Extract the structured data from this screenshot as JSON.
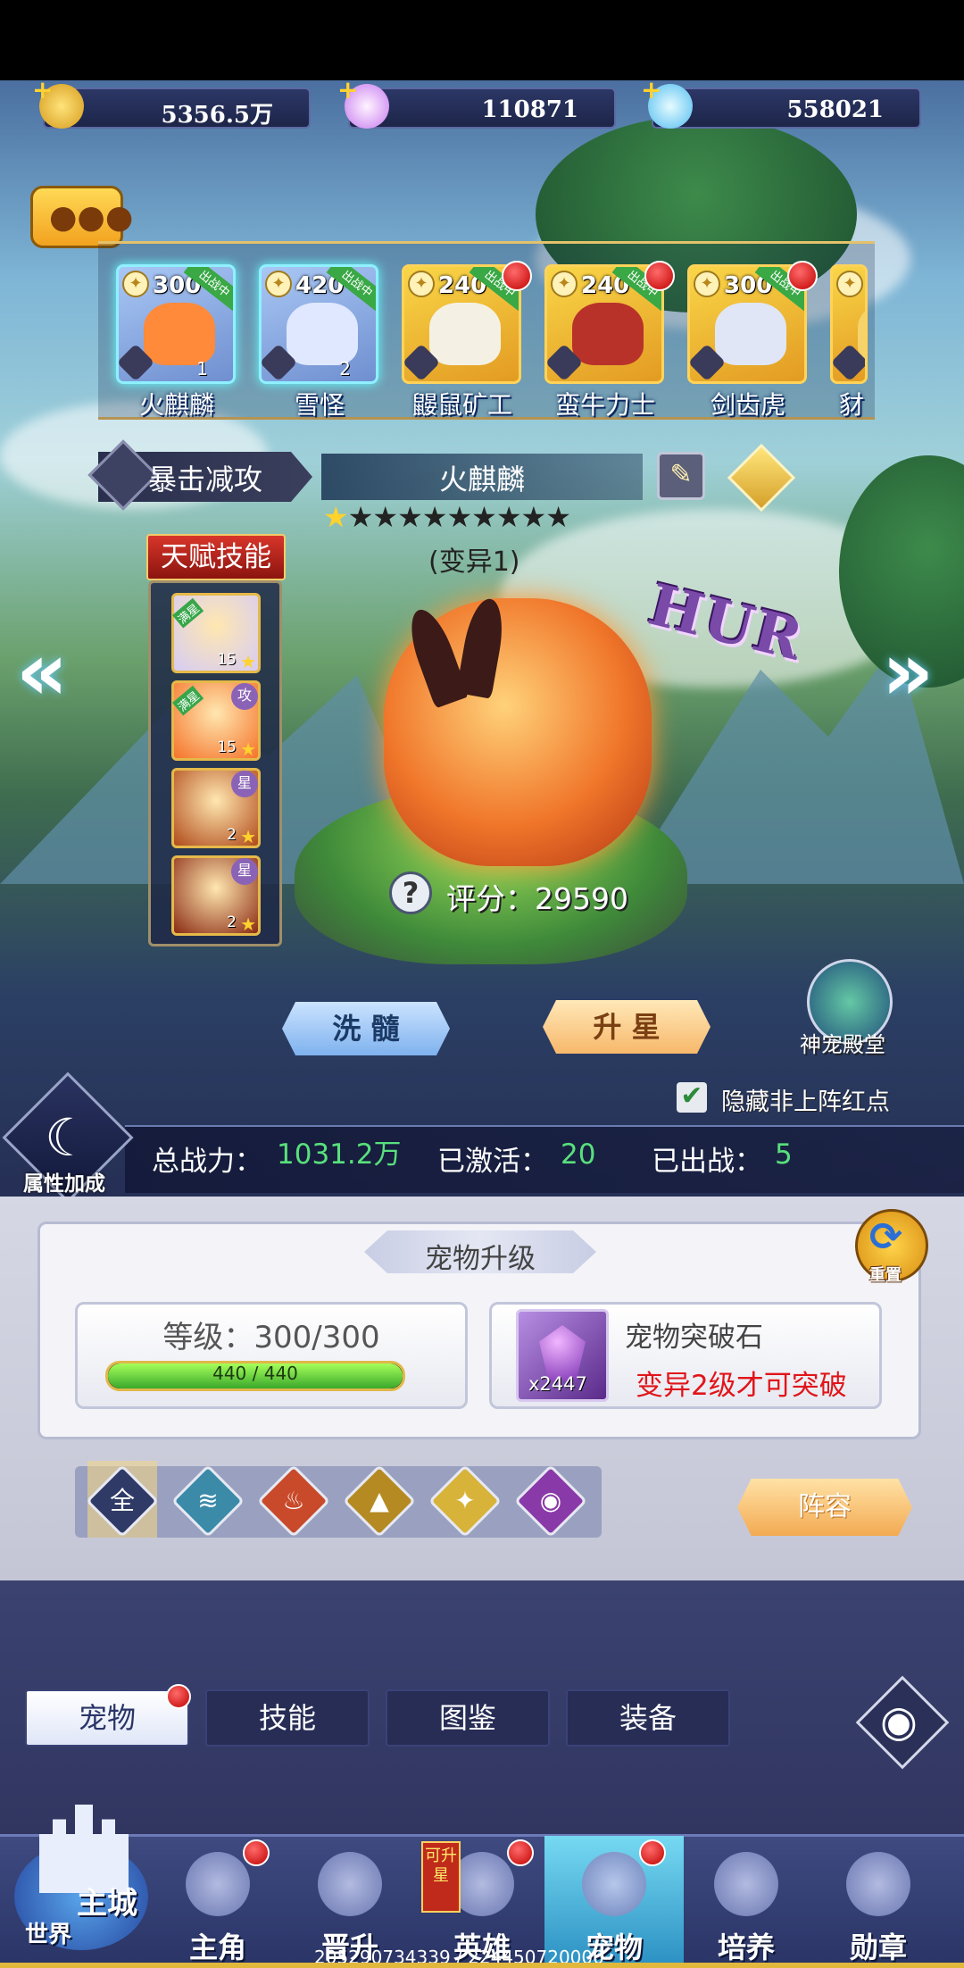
{
  "currency": [
    {
      "name": "gold",
      "value": "5356.5万",
      "color": "#f3c43e"
    },
    {
      "name": "rainbow-gem",
      "value": "110871",
      "color": "#d49af5"
    },
    {
      "name": "diamond",
      "value": "558021",
      "color": "#7ed4ff"
    }
  ],
  "pets": [
    {
      "level": "300",
      "name": "火麒麟",
      "badge": "出战中",
      "count": "1",
      "style": "blue",
      "art_color": "#ff8a3a"
    },
    {
      "level": "420",
      "name": "雪怪",
      "badge": "出战中",
      "count": "2",
      "style": "blue",
      "art_color": "#dfe8ff"
    },
    {
      "level": "240",
      "name": "鼹鼠矿工",
      "badge": "出战中",
      "count": "",
      "style": "gold",
      "art_color": "#f4f1e4"
    },
    {
      "level": "240",
      "name": "蛮牛力士",
      "badge": "出战中",
      "count": "",
      "style": "gold",
      "art_color": "#b8322a"
    },
    {
      "level": "300",
      "name": "剑齿虎",
      "badge": "出战中",
      "count": "",
      "style": "gold",
      "art_color": "#e0e6f5"
    },
    {
      "level": "",
      "name": "豺",
      "badge": "",
      "count": "",
      "style": "gold",
      "art_color": "#f5d36a"
    }
  ],
  "selected": {
    "attribute_label": "暴击减攻",
    "name": "火麒麟",
    "stars_text": "★★★★★★★★★★",
    "stars_gold": 1,
    "variant": "(变异1)",
    "rarity": "HUR",
    "score": "评分：29590",
    "help_symbol": "?"
  },
  "talent": {
    "title": "天赋技能",
    "skills": [
      {
        "level": "15",
        "tag": "满星",
        "corner": "",
        "color": "#d6ccf4"
      },
      {
        "level": "15",
        "tag": "满星",
        "corner": "攻",
        "color": "#f5732a"
      },
      {
        "level": "2",
        "tag": "",
        "corner": "星",
        "color": "#b04a1a"
      },
      {
        "level": "2",
        "tag": "",
        "corner": "星",
        "color": "#8a2a12"
      }
    ]
  },
  "buttons": {
    "wash": "洗 髓",
    "star_up": "升 星",
    "hall": "神宠殿堂",
    "hide_red_dots": "隐藏非上阵红点",
    "attr_bonus": "属性加成",
    "lineup": "阵容",
    "reset": "重置"
  },
  "summary": {
    "power_label": "总战力：",
    "power_value": "1031.2万",
    "activated_label": "已激活：",
    "activated_value": "20",
    "deployed_label": "已出战：",
    "deployed_value": "5"
  },
  "upgrade": {
    "title": "宠物升级",
    "level_label": "等级：300/300",
    "xp_text": "440 / 440",
    "xp_fraction": 1.0,
    "stone_name": "宠物突破石",
    "stone_count": "x2447",
    "stone_tip": "变异2级才可突破"
  },
  "filters": [
    {
      "name": "all",
      "glyph": "全",
      "color": "#2f3a66"
    },
    {
      "name": "wind",
      "glyph": "≋",
      "color": "#3a8aa8"
    },
    {
      "name": "fire",
      "glyph": "♨",
      "color": "#c84a2a"
    },
    {
      "name": "earth",
      "glyph": "▲",
      "color": "#b58a22"
    },
    {
      "name": "light",
      "glyph": "✦",
      "color": "#d8b33a"
    },
    {
      "name": "dark",
      "glyph": "◉",
      "color": "#8a3aa8"
    }
  ],
  "tabs": [
    {
      "label": "宠物",
      "active": true,
      "reddot": true
    },
    {
      "label": "技能",
      "active": false,
      "reddot": false
    },
    {
      "label": "图鉴",
      "active": false,
      "reddot": false
    },
    {
      "label": "装备",
      "active": false,
      "reddot": false
    }
  ],
  "bottom_nav": {
    "main_city": "主城",
    "world": "世界",
    "upstar_tag": "可升星",
    "items": [
      {
        "label": "主角",
        "reddot": true
      },
      {
        "label": "晋升",
        "reddot": false
      },
      {
        "label": "英雄",
        "reddot": true
      },
      {
        "label": "宠物",
        "reddot": true
      },
      {
        "label": "培养",
        "reddot": false
      },
      {
        "label": "勋章",
        "reddot": false
      }
    ]
  },
  "footer": "205290734339 / 224450720000"
}
